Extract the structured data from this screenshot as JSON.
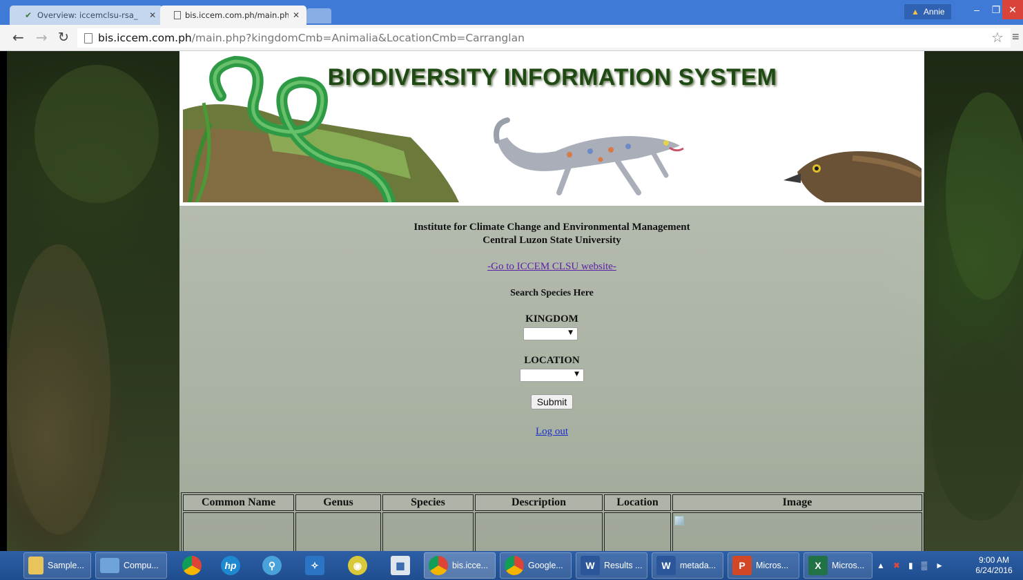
{
  "browser": {
    "tabs": [
      {
        "title": "Overview: iccemclsu-rsa_",
        "active": false
      },
      {
        "title": "bis.iccem.com.ph/main.ph",
        "active": true
      }
    ],
    "profile_name": "Annie",
    "url_host": "bis.iccem.com.ph",
    "url_path": "/main.php?kingdomCmb=Animalia&LocationCmb=Carranglan"
  },
  "banner": {
    "title": "BIODIVERSITY INFORMATION SYSTEM"
  },
  "page": {
    "institute_line1": "Institute for Climate Change and Environmental Management",
    "institute_line2": "Central Luzon State University",
    "website_link": "-Go to ICCEM CLSU website-",
    "search_title": "Search Species Here",
    "kingdom_label": "KINGDOM",
    "kingdom_value": "",
    "location_label": "LOCATION",
    "location_value": "",
    "submit_label": "Submit",
    "logout_label": "Log out"
  },
  "results_table": {
    "headers": [
      "Common Name",
      "Genus",
      "Species",
      "Description",
      "Location",
      "Image"
    ]
  },
  "taskbar": {
    "items": [
      "Sample...",
      "Compu...",
      "bis.icce...",
      "Google...",
      "Results ...",
      "metada...",
      "Micros...",
      "Micros..."
    ],
    "time": "9:00 AM",
    "date": "6/24/2016"
  },
  "colors": {
    "tabbar": "#3f7ad6",
    "banner_title": "#1f4a14",
    "link_visited": "#5a1fa6",
    "link": "#1a2fd0",
    "taskbar": "#2d5fa6"
  }
}
